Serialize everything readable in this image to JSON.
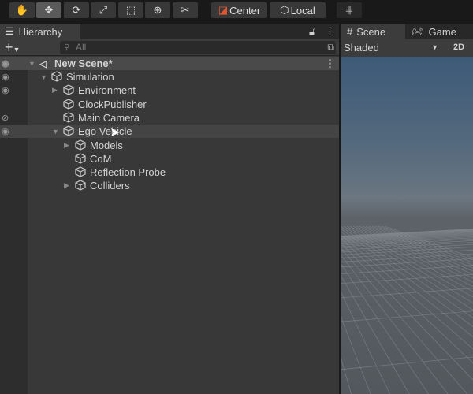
{
  "toolbar": {
    "tools": [
      "hand-tool",
      "move-tool",
      "rotate-tool",
      "scale-tool",
      "rect-tool",
      "transform-tool",
      "custom-tool"
    ],
    "pivot_label": "Center",
    "space_label": "Local"
  },
  "hierarchy": {
    "tab_label": "Hierarchy",
    "search_placeholder": "All",
    "scene_name": "New Scene*",
    "items": [
      {
        "label": "Simulation",
        "depth": 1,
        "expand": "open"
      },
      {
        "label": "Environment",
        "depth": 2,
        "expand": "closed"
      },
      {
        "label": "ClockPublisher",
        "depth": 2,
        "expand": "none"
      },
      {
        "label": "Main Camera",
        "depth": 2,
        "expand": "none"
      },
      {
        "label": "Ego Vehicle",
        "depth": 2,
        "expand": "open"
      },
      {
        "label": "Models",
        "depth": 3,
        "expand": "closed"
      },
      {
        "label": "CoM",
        "depth": 3,
        "expand": "none"
      },
      {
        "label": "Reflection Probe",
        "depth": 3,
        "expand": "none"
      },
      {
        "label": "Colliders",
        "depth": 3,
        "expand": "closed"
      }
    ]
  },
  "scene_view": {
    "tab_scene": "Scene",
    "tab_game": "Game",
    "draw_mode": "Shaded",
    "mode_2d": "2D"
  },
  "colors": {
    "accent_orange": "#e0562f",
    "panel": "#383838",
    "sky": "#3d5a78"
  }
}
